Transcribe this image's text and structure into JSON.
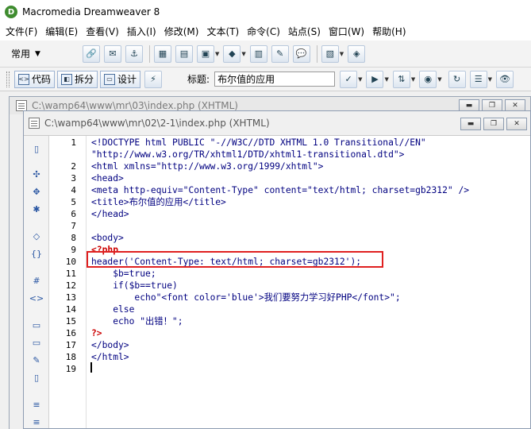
{
  "window": {
    "title": "Macromedia Dreamweaver 8",
    "app_icon": "dreamweaver-logo-icon"
  },
  "menu": [
    "文件(F)",
    "编辑(E)",
    "查看(V)",
    "插入(I)",
    "修改(M)",
    "文本(T)",
    "命令(C)",
    "站点(S)",
    "窗口(W)",
    "帮助(H)"
  ],
  "insert_bar": {
    "category": "常用",
    "icons": [
      "hyperlink-icon",
      "email-link-icon",
      "named-anchor-icon",
      "table-icon",
      "layer-icon",
      "image-icon",
      "media-icon",
      "date-icon",
      "comment-icon",
      "tag-chooser-icon",
      "templates-icon",
      "tag-icon"
    ]
  },
  "document_toolbar": {
    "views": [
      {
        "label": "代码",
        "icon": "code-view-icon"
      },
      {
        "label": "拆分",
        "icon": "split-view-icon"
      },
      {
        "label": "设计",
        "icon": "design-view-icon"
      }
    ],
    "title_label": "标题:",
    "title_value": "布尔值的应用",
    "icons": [
      "browser-check-icon",
      "validate-icon",
      "file-management-icon",
      "preview-browser-icon",
      "refresh-icon",
      "view-options-icon",
      "visual-aids-icon"
    ]
  },
  "back_window": {
    "title": "C:\\wamp64\\www\\mr\\03\\index.php (XHTML)"
  },
  "front_window": {
    "title": "C:\\wamp64\\www\\mr\\02\\2-1\\index.php (XHTML)"
  },
  "code_lines": [
    {
      "n": "1",
      "segments": [
        {
          "t": "<!DOCTYPE html PUBLIC \"-//W3C//DTD XHTML 1.0 Transitional//EN\"",
          "c": "tag"
        }
      ]
    },
    {
      "n": "",
      "segments": [
        {
          "t": "\"http://www.w3.org/TR/xhtml1/DTD/xhtml1-transitional.dtd\">",
          "c": "tag"
        }
      ]
    },
    {
      "n": "2",
      "segments": [
        {
          "t": "<html xmlns=\"http://www.w3.org/1999/xhtml\">",
          "c": "tag"
        }
      ]
    },
    {
      "n": "3",
      "segments": [
        {
          "t": "<head>",
          "c": "tag"
        }
      ]
    },
    {
      "n": "4",
      "segments": [
        {
          "t": "<meta http-equiv=\"Content-Type\" content=\"text/html; charset=gb2312\" />",
          "c": "tag"
        }
      ]
    },
    {
      "n": "5",
      "segments": [
        {
          "t": "<title>布尔值的应用</title>",
          "c": "tag"
        }
      ]
    },
    {
      "n": "6",
      "segments": [
        {
          "t": "</head>",
          "c": "tag"
        }
      ]
    },
    {
      "n": "7",
      "segments": []
    },
    {
      "n": "8",
      "segments": [
        {
          "t": "<body>",
          "c": "tag"
        }
      ]
    },
    {
      "n": "9",
      "segments": [
        {
          "t": "<?php",
          "c": "php"
        }
      ]
    },
    {
      "n": "10",
      "segments": [
        {
          "t": "header('Content-Type: text/html; charset=gb2312');",
          "c": "plain"
        }
      ]
    },
    {
      "n": "11",
      "segments": [
        {
          "t": "    $b=true;",
          "c": "plain"
        }
      ]
    },
    {
      "n": "12",
      "segments": [
        {
          "t": "    if($b==true)",
          "c": "plain"
        }
      ]
    },
    {
      "n": "13",
      "segments": [
        {
          "t": "        echo\"<font color='blue'>我们要努力学习好PHP</font>\";",
          "c": "plain"
        }
      ]
    },
    {
      "n": "14",
      "segments": [
        {
          "t": "    else",
          "c": "plain"
        }
      ]
    },
    {
      "n": "15",
      "segments": [
        {
          "t": "    echo \"出错！\";",
          "c": "plain"
        }
      ]
    },
    {
      "n": "16",
      "segments": [
        {
          "t": "?>",
          "c": "php"
        }
      ]
    },
    {
      "n": "17",
      "segments": [
        {
          "t": "</body>",
          "c": "tag"
        }
      ]
    },
    {
      "n": "18",
      "segments": [
        {
          "t": "</html>",
          "c": "tag"
        }
      ]
    },
    {
      "n": "19",
      "segments": []
    }
  ],
  "highlight": {
    "line": "10",
    "color": "#e02020"
  },
  "colors": {
    "tag": "#000080",
    "php": "#cc0000",
    "highlight_box": "#e02020"
  }
}
